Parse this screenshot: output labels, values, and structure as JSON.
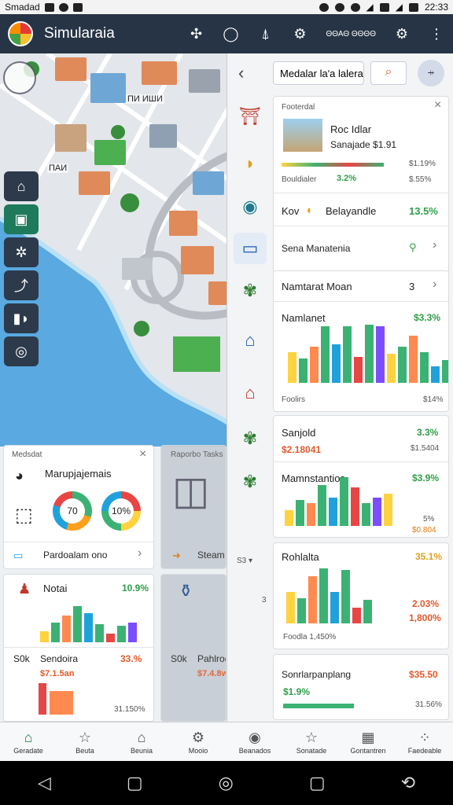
{
  "status": {
    "carrier": "Smadad",
    "time": "22:33"
  },
  "header": {
    "title": "Simularaia",
    "unit_label": "ΘΘΑΘ ΘΘΘΘ"
  },
  "map": {
    "label1": "ПИ ИШИ",
    "label2": "ПАИ"
  },
  "panel": {
    "search_text": "Medalar laʹa lalera",
    "card1": {
      "header": "Footerdal",
      "title": "Roc Idlar",
      "subtitle": "Sanajade $1.91",
      "price1": "$1.19%",
      "row_label": "Bouldialer",
      "row_value": "3.2%",
      "price2": "$.55%",
      "item2_label": "Kov",
      "item2_name": "Belayandle",
      "item2_value": "13.5%",
      "item3_name": "Sena Manatenia"
    },
    "card2": {
      "header": "Namtarat Moan",
      "count": "3",
      "title": "Namlanet",
      "value": "$3.3%",
      "left_footer": "Foolirs",
      "right_footer": "$14%"
    },
    "card3": {
      "label": "Sanjold",
      "value": "3.3%",
      "sub_left": "$2.18041",
      "sub_right": "$1.5404",
      "title": "Mamnstantios",
      "value2": "$3.9%",
      "foot1": "5%",
      "foot2": "$0.804"
    },
    "card4": {
      "title": "Rohlalta",
      "value": "35.1%",
      "right1": "2.03%",
      "right2": "1,800%",
      "foot": "Foodla 1,450%",
      "side_label": "3"
    },
    "card5": {
      "title": "Sonrlarpanplang",
      "value": "$35.50",
      "sub": "$1.9%",
      "foot": "31.56%"
    }
  },
  "left_cards": {
    "card1": {
      "header": "Medsdat",
      "title": "Marupjajemais",
      "donut1": "70",
      "donut2": "10%",
      "row_label": "Pardoalam ono"
    },
    "card2": {
      "title": "Notai",
      "value": "10.9%",
      "left": "S0k",
      "name": "Sendoira",
      "value2": "33.%",
      "sub": "$7.1.5an",
      "foot": "31.150%"
    },
    "card3": {
      "title": "Raporbo Tasks",
      "button": "Steam"
    },
    "card4": {
      "left": "S0k",
      "name": "Pahlrodi",
      "sub": "$7.4.8w"
    }
  },
  "bottom_nav": [
    {
      "label": "Geradate",
      "icon": "home-icon"
    },
    {
      "label": "Beuta",
      "icon": "star-icon"
    },
    {
      "label": "Beunia",
      "icon": "house-icon"
    },
    {
      "label": "Mooio",
      "icon": "gear-icon"
    },
    {
      "label": "Beanados",
      "icon": "circle-icon"
    },
    {
      "label": "Sonatade",
      "icon": "star-icon"
    },
    {
      "label": "Gontantren",
      "icon": "building-icon"
    },
    {
      "label": "Faedeable",
      "icon": "grid-icon"
    }
  ],
  "chart_data": [
    {
      "type": "bar",
      "values": [
        38,
        30,
        45,
        70,
        48,
        70,
        32,
        72,
        70,
        36,
        45,
        58,
        38,
        20,
        28,
        30
      ]
    },
    {
      "type": "bar",
      "values": [
        12,
        20,
        18,
        32,
        22,
        38,
        30,
        18,
        22,
        25
      ]
    },
    {
      "type": "bar",
      "values": [
        40,
        32,
        60,
        70,
        40,
        68,
        20,
        30
      ]
    },
    {
      "type": "bar",
      "values": [
        12,
        22,
        30,
        40,
        32,
        20,
        10,
        18,
        22
      ]
    }
  ]
}
